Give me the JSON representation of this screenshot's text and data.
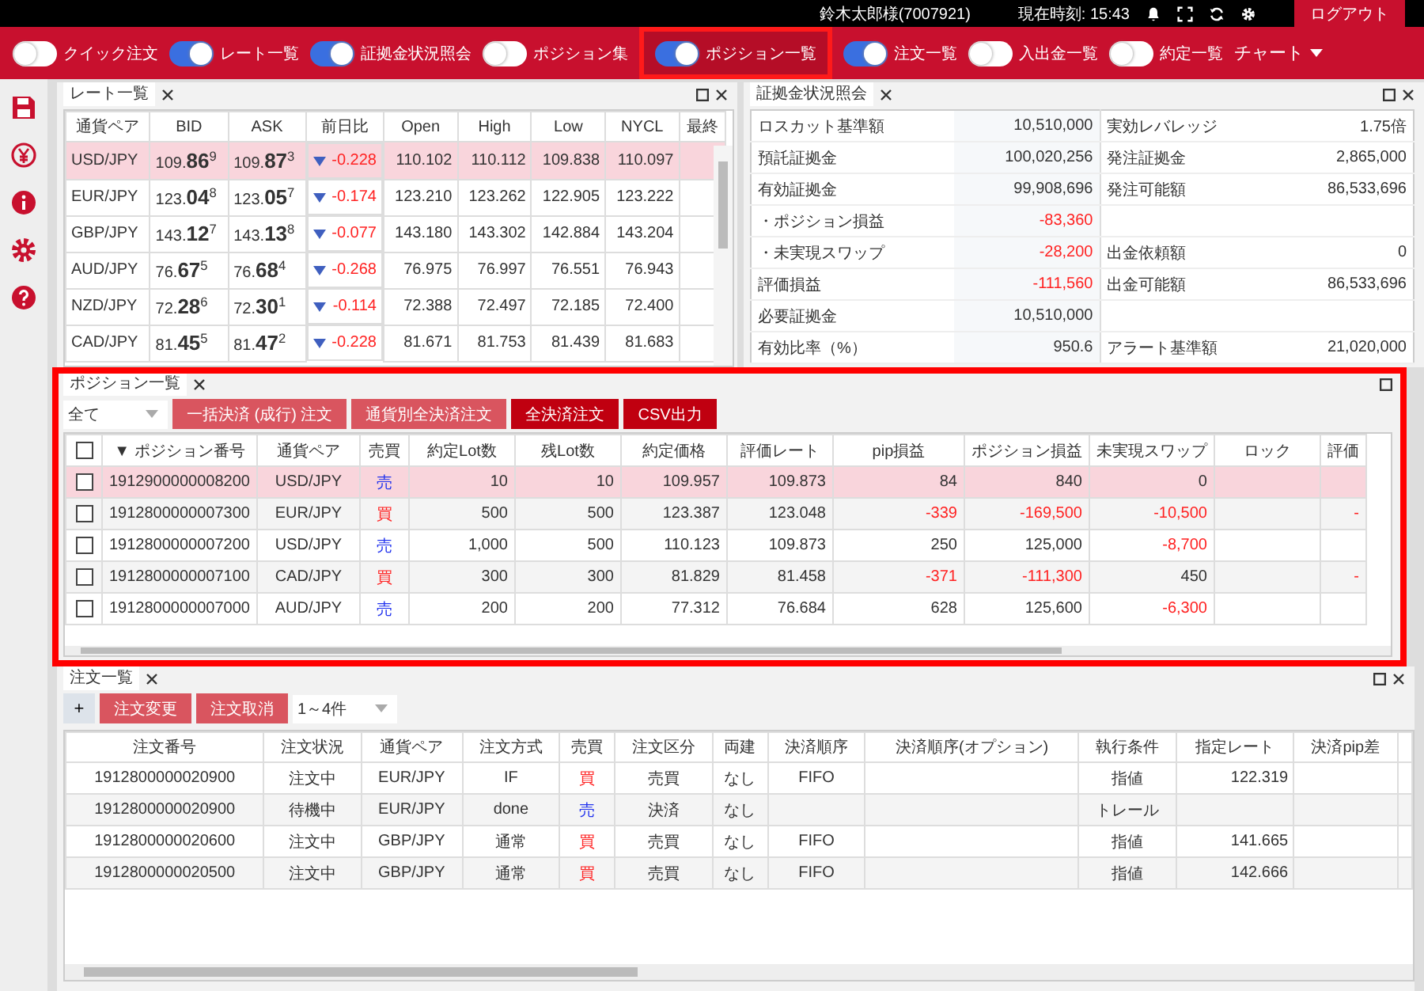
{
  "topbar": {
    "user": "鈴木太郎様(7007921)",
    "time_label": "現在時刻: 15:43",
    "logout": "ログアウト"
  },
  "toolbar": {
    "toggles": [
      {
        "label": "クイック注文",
        "on": false,
        "highlighted": false
      },
      {
        "label": "レート一覧",
        "on": true,
        "highlighted": false
      },
      {
        "label": "証拠金状況照会",
        "on": true,
        "highlighted": false
      },
      {
        "label": "ポジション集",
        "on": false,
        "highlighted": false
      },
      {
        "label": "ポジション一覧",
        "on": true,
        "highlighted": true
      },
      {
        "label": "注文一覧",
        "on": true,
        "highlighted": false
      },
      {
        "label": "入出金一覧",
        "on": false,
        "highlighted": false
      },
      {
        "label": "約定一覧",
        "on": false,
        "highlighted": false
      }
    ],
    "chart": "チャート"
  },
  "sidebar": {
    "icons": [
      {
        "kind": "save"
      },
      {
        "kind": "yen"
      },
      {
        "kind": "info"
      },
      {
        "kind": "settings"
      },
      {
        "kind": "help"
      }
    ]
  },
  "rate_panel": {
    "title": "レート一覧",
    "columns": [
      "通貨ペア",
      "BID",
      "ASK",
      "前日比",
      "Open",
      "High",
      "Low",
      "NYCL",
      "最終"
    ],
    "rows": [
      {
        "pair": "USD/JPY",
        "bid": "109.**86**$^{9}$",
        "ask": "109.**87**$^{3}$",
        "change": "-0.228",
        "open": "110.102",
        "high": "110.112",
        "low": "109.838",
        "nycl": "110.097",
        "selected": true
      },
      {
        "pair": "EUR/JPY",
        "bid": "123.**04**$^{8}$",
        "ask": "123.**05**$^{7}$",
        "change": "-0.174",
        "open": "123.210",
        "high": "123.262",
        "low": "122.905",
        "nycl": "123.222",
        "selected": false
      },
      {
        "pair": "GBP/JPY",
        "bid": "143.**12**$^{7}$",
        "ask": "143.**13**$^{8}$",
        "change": "-0.077",
        "open": "143.180",
        "high": "143.302",
        "low": "142.884",
        "nycl": "143.204",
        "selected": false
      },
      {
        "pair": "AUD/JPY",
        "bid": "76.**67**$^{5}$",
        "ask": "76.**68**$^{4}$",
        "change": "-0.268",
        "open": "76.975",
        "high": "76.997",
        "low": "76.551",
        "nycl": "76.943",
        "selected": false
      },
      {
        "pair": "NZD/JPY",
        "bid": "72.**28**$^{6}$",
        "ask": "72.**30**$^{1}$",
        "change": "-0.114",
        "open": "72.388",
        "high": "72.497",
        "low": "72.185",
        "nycl": "72.400",
        "selected": false
      },
      {
        "pair": "CAD/JPY",
        "bid": "81.**45**$^{5}$",
        "ask": "81.**47**$^{2}$",
        "change": "-0.228",
        "open": "81.671",
        "high": "81.753",
        "low": "81.439",
        "nycl": "81.683",
        "selected": false
      }
    ]
  },
  "margin_panel": {
    "title": "証拠金状況照会",
    "rows": [
      {
        "label": "ロスカット基準額",
        "value": "10,510,000",
        "negative": false,
        "label2": "実効レバレッジ",
        "value2": "1.75倍"
      },
      {
        "label": "預託証拠金",
        "value": "100,020,256",
        "negative": false,
        "label2": "発注証拠金",
        "value2": "2,865,000"
      },
      {
        "label": "有効証拠金",
        "value": "99,908,696",
        "negative": false,
        "label2": "発注可能額",
        "value2": "86,533,696"
      },
      {
        "label": "・ポジション損益",
        "value": "-83,360",
        "negative": true
      },
      {
        "label": "・未実現スワップ",
        "value": "-28,200",
        "negative": true,
        "label2": "出金依頼額",
        "value2": "0"
      },
      {
        "label": "評価損益",
        "value": "-111,560",
        "negative": true,
        "label2": "出金可能額",
        "value2": "86,533,696"
      },
      {
        "label": "必要証拠金",
        "value": "10,510,000",
        "negative": false
      },
      {
        "label": "有効比率（%）",
        "value": "950.6",
        "negative": false,
        "label2": "アラート基準額",
        "value2": "21,020,000"
      }
    ]
  },
  "position_panel": {
    "title": "ポジション一覧",
    "highlighted": true,
    "select_all_checked": false,
    "filter": "全て",
    "buttons": [
      {
        "label": "一括決済 (成行) 注文",
        "kind": "light"
      },
      {
        "label": "通貨別全決済注文",
        "kind": "light"
      },
      {
        "label": "全決済注文",
        "kind": "dark"
      },
      {
        "label": "CSV出力",
        "kind": "dark"
      }
    ],
    "columns": [
      "▼ ポジション番号",
      "通貨ペア",
      "売買",
      "約定Lot数",
      "残Lot数",
      "約定価格",
      "評価レート",
      "pip損益",
      "ポジション損益",
      "未実現スワップ",
      "ロック",
      "評価"
    ],
    "rows": [
      {
        "checked": false,
        "selected": true,
        "cells": [
          "1912900000008200",
          "USD/JPY",
          "売",
          "10",
          "10",
          "109.957",
          "109.873",
          "84",
          "840",
          "0"
        ],
        "color": "#2233ee"
      },
      {
        "checked": false,
        "selected": false,
        "cells": [
          "1912800000007300",
          "EUR/JPY",
          "買",
          "500",
          "500",
          "123.387",
          "123.048",
          "-339",
          "-169,500",
          "-10,500"
        ],
        "color": "#ff2222",
        "last": "-"
      },
      {
        "checked": false,
        "selected": false,
        "cells": [
          "1912800000007200",
          "USD/JPY",
          "売",
          "1,000",
          "500",
          "110.123",
          "109.873",
          "250",
          "125,000",
          "-8,700"
        ],
        "color": "#2233ee"
      },
      {
        "checked": false,
        "selected": false,
        "cells": [
          "1912800000007100",
          "CAD/JPY",
          "買",
          "300",
          "300",
          "81.829",
          "81.458",
          "-371",
          "-111,300",
          "450"
        ],
        "color": "#ff2222",
        "last": "-"
      },
      {
        "checked": false,
        "selected": false,
        "cells": [
          "1912800000007000",
          "AUD/JPY",
          "売",
          "200",
          "200",
          "77.312",
          "76.684",
          "628",
          "125,600",
          "-6,300"
        ],
        "color": "#2233ee"
      }
    ]
  },
  "order_panel": {
    "title": "注文一覧",
    "add": "+",
    "buttons": [
      "注文変更",
      "注文取消"
    ],
    "range": "1～4件",
    "columns": [
      "注文番号",
      "注文状況",
      "通貨ペア",
      "注文方式",
      "売買",
      "注文区分",
      "両建",
      "決済順序",
      "決済順序(オプション)",
      "執行条件",
      "指定レート",
      "決済pip差"
    ],
    "rows": [
      {
        "color": "#ff2222",
        "cells": [
          "1912800000020900",
          "注文中",
          "EUR/JPY",
          "IF",
          "買",
          "売買",
          "なし",
          "FIFO",
          "",
          "指値",
          "122.319",
          ""
        ]
      },
      {
        "color": "#2233ee",
        "cells": [
          "1912800000020900",
          "待機中",
          "EUR/JPY",
          "done",
          "売",
          "決済",
          "なし",
          "",
          "",
          "トレール",
          "",
          ""
        ]
      },
      {
        "color": "#ff2222",
        "cells": [
          "1912800000020600",
          "注文中",
          "GBP/JPY",
          "通常",
          "買",
          "売買",
          "なし",
          "FIFO",
          "",
          "指値",
          "141.665",
          ""
        ]
      },
      {
        "color": "#ff2222",
        "cells": [
          "1912800000020500",
          "注文中",
          "GBP/JPY",
          "通常",
          "買",
          "売買",
          "なし",
          "FIFO",
          "",
          "指値",
          "142.666",
          ""
        ]
      }
    ]
  }
}
